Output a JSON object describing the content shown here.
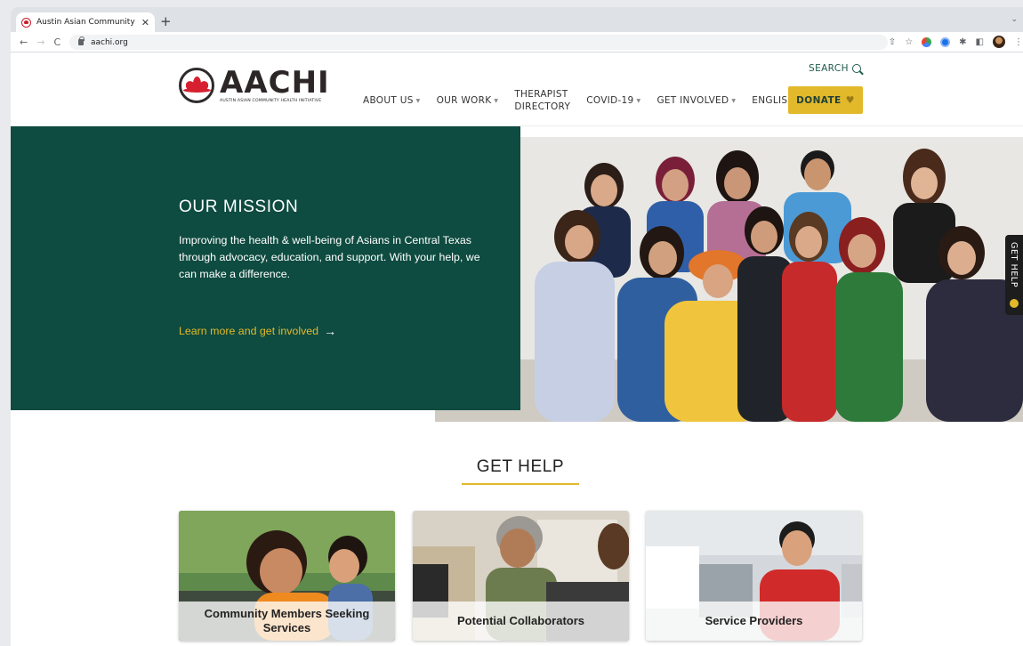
{
  "browser": {
    "tab_title": "Austin Asian Community Healt",
    "url": "aachi.org",
    "new_tab_icon": "plus-icon",
    "nav_icons": [
      "back-icon",
      "forward-icon",
      "reload-icon"
    ]
  },
  "header": {
    "logo_text": "AACHI",
    "logo_subtitle": "AUSTIN ASIAN COMMUNITY HEALTH INITIATIVE",
    "search_label": "SEARCH",
    "menu": [
      {
        "label": "ABOUT US",
        "dropdown": true
      },
      {
        "label": "OUR WORK",
        "dropdown": true
      },
      {
        "label_line1": "THERAPIST",
        "label_line2": "DIRECTORY",
        "dropdown": false
      },
      {
        "label": "COVID-19",
        "dropdown": true
      },
      {
        "label": "GET INVOLVED",
        "dropdown": true
      },
      {
        "label": "ENGLISH",
        "dropdown": true
      }
    ],
    "donate_label": "DONATE",
    "colors": {
      "green": "#0e4b40",
      "gold": "#e2b92a",
      "brand_red": "#d6202f"
    }
  },
  "hero": {
    "heading": "OUR MISSION",
    "body": "Improving the health & well-being of Asians in Central Texas through advocacy, education, and support. With your help, we can make a difference.",
    "link_text": "Learn more and get involved",
    "arrow": "→",
    "side_tab": "GET HELP"
  },
  "get_help": {
    "title": "GET HELP",
    "cards": [
      {
        "caption": "Community Members Seeking Services"
      },
      {
        "caption": "Potential Collaborators"
      },
      {
        "caption": "Service Providers"
      }
    ]
  }
}
